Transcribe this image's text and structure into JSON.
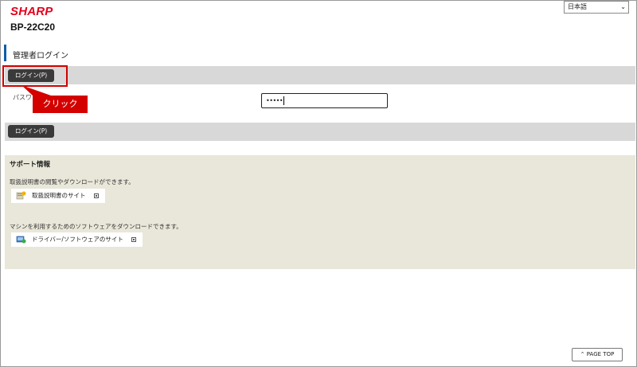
{
  "header": {
    "logo": "SHARP",
    "model": "BP-22C20",
    "language": "日本語"
  },
  "login": {
    "page_title": "管理者ログイン",
    "button_label": "ログイン(P)",
    "password_label": "パスワ",
    "password_value": "•••••"
  },
  "annotation": {
    "callout": "クリック"
  },
  "support": {
    "title": "サポート情報",
    "manual_desc": "取扱説明書の閲覧やダウンロードができます。",
    "manual_link": "取扱説明書のサイト",
    "driver_desc": "マシンを利用するためのソフトウェアをダウンロードできます。",
    "driver_link": "ドライバー/ソフトウェアのサイト"
  },
  "footer": {
    "page_top": "PAGE TOP"
  },
  "colors": {
    "brand": "#e4001b",
    "accent": "#0f5ea8",
    "callout": "#d40000"
  }
}
